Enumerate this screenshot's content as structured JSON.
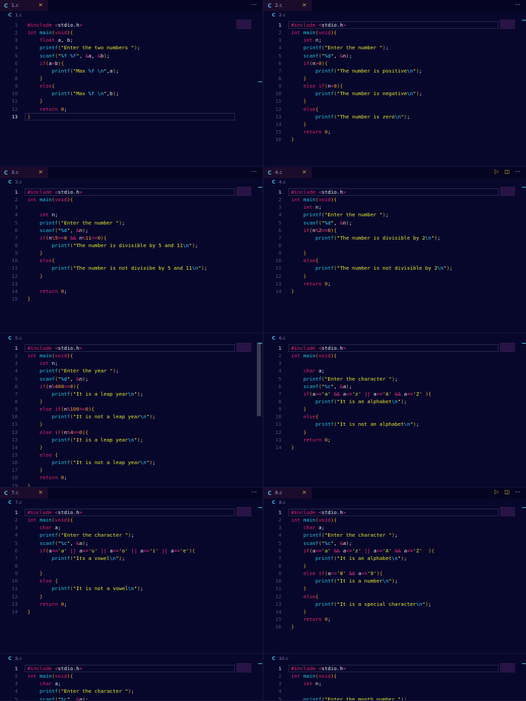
{
  "colors": {
    "background": "#07072b",
    "keyword": "#e8206e",
    "function": "#22c4e0",
    "string": "#e2e22e",
    "brace": "#e0a820"
  },
  "icons": {
    "file": "c-language-icon",
    "close": "close-icon",
    "more": "more-actions-icon",
    "run": "run-icon",
    "split": "split-editor-icon"
  },
  "panes": [
    {
      "tab": "1.c",
      "crumb": "1.c",
      "cur": 13,
      "run": false,
      "lines": [
        "#include <stdio.h>",
        "int main(void){",
        "    float a, b;",
        "    printf(\"Enter the two numbers \");",
        "    scanf(\"%f %f\", &a, &b);",
        "    if(a>b){",
        "        printf(\"Max %f \\n\",a);",
        "    }",
        "    else{",
        "        printf(\"Max %f \\n\",b);",
        "    }",
        "    return 0;",
        "}"
      ]
    },
    {
      "tab": "2.c",
      "crumb": "2.c",
      "cur": 1,
      "run": false,
      "lines": [
        "#include <stdio.h>",
        "int main(void){",
        "    int n;",
        "    printf(\"Enter the number \");",
        "    scanf(\"%d\", &n);",
        "    if(n>0){",
        "        printf(\"The number is positive\\n\");",
        "    }",
        "    else if(n<0){",
        "        printf(\"The number is negative\\n\");",
        "    }",
        "    else{",
        "        printf(\"The number is zero\\n\");",
        "    }",
        "    return 0;",
        "}"
      ]
    },
    {
      "tab": "3.c",
      "crumb": "3.c",
      "cur": 1,
      "run": false,
      "lines": [
        "#include <stdio.h>",
        "int main(void){",
        "",
        "    int n;",
        "    printf(\"Enter the number \");",
        "    scanf(\"%d\", &n);",
        "    if(n%5==0 && n%11==0){",
        "        printf(\"The number is divisible by 5 and 11\\n\");",
        "    }",
        "    else{",
        "        printf(\"The number is not divisibe by 5 and 11\\n\");",
        "    }",
        "",
        "    return 0;",
        "}"
      ]
    },
    {
      "tab": "4.c",
      "crumb": "4.c",
      "cur": 1,
      "run": true,
      "lines": [
        "#include <stdio.h>",
        "int main(void){",
        "    int n;",
        "    printf(\"Enter the number \");",
        "    scanf(\"%d\", &n);",
        "    if(n%2==0){",
        "        printf(\"The number is divisible by 2\\n\");",
        "",
        "    }",
        "    else{",
        "        printf(\"The number is not divisible by 2\\n\");",
        "    }",
        "    return 0;",
        "}"
      ]
    },
    {
      "tab": null,
      "crumb": "5.c",
      "cur": 1,
      "run": false,
      "lines": [
        "#include <stdio.h>",
        "int main(void){",
        "    int n;",
        "    printf(\"Enter the year \");",
        "    scanf(\"%d\", &n);",
        "    if(n%400==0){",
        "        printf(\"It is a leap year\\n\");",
        "    }",
        "    else if(n%100==0){",
        "        printf(\"It is not a leap year\\n\");",
        "    }",
        "    else if(n%4==0){",
        "        printf(\"It is a leap year\\n\");",
        "    }",
        "    else {",
        "        printf(\"It is not a leap year\\n\");",
        "    }",
        "    return 0;",
        "}"
      ]
    },
    {
      "tab": null,
      "crumb": "6.c",
      "cur": 1,
      "run": false,
      "lines": [
        "#include <stdio.h>",
        "int main(void){",
        "",
        "    char a;",
        "    printf(\"Enter the character \");",
        "    scanf(\"%c\", &a);",
        "    if(a>='a' && a<='z' || a>='A' && a<='Z' ){",
        "        printf(\"It is an alphabet\\n\");",
        "    }",
        "    else{",
        "        printf(\"It is not an alphabet\\n\");",
        "    }",
        "    return 0;",
        "}"
      ]
    },
    {
      "tab": "7.c",
      "crumb": "7.c",
      "cur": 1,
      "run": false,
      "lines": [
        "#include <stdio.h>",
        "int main(void){",
        "    char a;",
        "    printf(\"Enter the character \");",
        "    scanf(\"%c\", &a);",
        "    if(a=='a' || a=='u' || a=='o' || a=='i' || a=='e'){",
        "        printf(\"Its a vowel\\n\");",
        "",
        "    }",
        "    else {",
        "        printf(\"It is not a vowel\\n\");",
        "    }",
        "    return 0;",
        "}"
      ]
    },
    {
      "tab": "8.c",
      "crumb": "8.c",
      "cur": 1,
      "run": true,
      "lines": [
        "#include <stdio.h>",
        "int main(void){",
        "    char a;",
        "    printf(\"Enter the character \");",
        "    scanf(\"%c\", &a);",
        "    if(a>='a' && a<='z' || a>='A' && a<='Z'  ){",
        "        printf(\"It is an alphabet\\n\");",
        "    }",
        "    else if(a>='0' && a<='9'){",
        "        printf(\"It is a number\\n\");",
        "    }",
        "    else{",
        "        printf(\"It is a special character\\n\");",
        "    }",
        "    return 0;",
        "}"
      ]
    },
    {
      "tab": null,
      "crumb": "9.c",
      "cur": 1,
      "run": false,
      "lines": [
        "#include <stdio.h>",
        "int main(void){",
        "    char a;",
        "    printf(\"Enter the character \");",
        "    scanf(\"%c\", &a);"
      ]
    },
    {
      "tab": null,
      "crumb": "10.c",
      "cur": 1,
      "run": false,
      "lines": [
        "#include <stdio.h>",
        "int main(void){",
        "    int n;",
        "",
        "    printf(\"Enter the month number \");"
      ]
    }
  ]
}
